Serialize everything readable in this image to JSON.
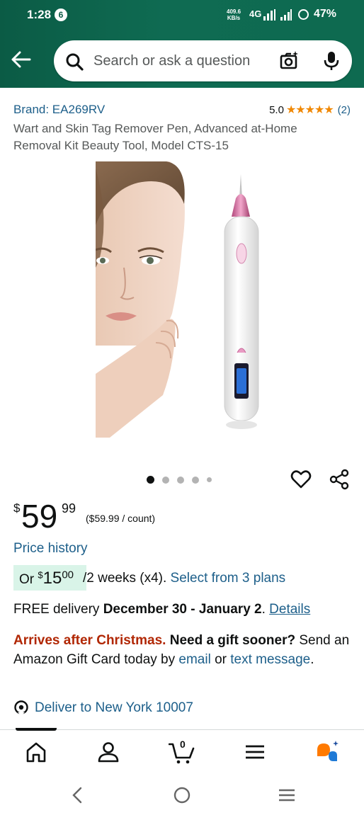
{
  "status_bar": {
    "time": "1:28",
    "notification_count": "6",
    "speed_value": "409.6",
    "speed_unit": "KB/s",
    "network": "4G",
    "battery": "47%"
  },
  "search": {
    "placeholder": "Search or ask a question"
  },
  "product": {
    "brand": "Brand: EA269RV",
    "rating_value": "5.0",
    "stars": "★★★★★",
    "rating_count": "(2)",
    "title": "Wart and Skin Tag Remover Pen, Advanced at-Home Removal Kit Beauty Tool, Model CTS-15",
    "image_alt": "Woman's face with a white and pink skin tag remover pen",
    "carousel_total": 5,
    "carousel_active": 1
  },
  "price": {
    "currency": "$",
    "whole": "59",
    "fraction": "99",
    "unit_price": "($59.99 / count)",
    "history_label": "Price history"
  },
  "installment": {
    "prefix": "Or ",
    "currency": "$",
    "amount": "15",
    "cents": "00",
    "period": "/2 weeks (x4). ",
    "plans_link": "Select from 3 plans"
  },
  "delivery": {
    "free_label": "FREE delivery ",
    "dates": "December 30 - January 2",
    "separator": ". ",
    "details_link": "Details"
  },
  "gift": {
    "warning": "Arrives after Christmas.",
    "question": " Need a gift sooner?",
    "text1": " Send an Amazon Gift Card today by ",
    "email_link": "email",
    "text2": " or ",
    "text_link": "text message",
    "text3": "."
  },
  "location": {
    "label": "Deliver to New York 10007"
  },
  "bottom_nav": {
    "cart_count": "0",
    "items": [
      "home-icon",
      "account-icon",
      "cart-icon",
      "menu-icon",
      "assistant-icon"
    ]
  },
  "colors": {
    "header": "#0f6b52",
    "link": "#1d5f8a",
    "star": "#f08804",
    "alert": "#b12704",
    "installment_bg": "#d9f4e8",
    "assistant": "#ff7a00"
  }
}
